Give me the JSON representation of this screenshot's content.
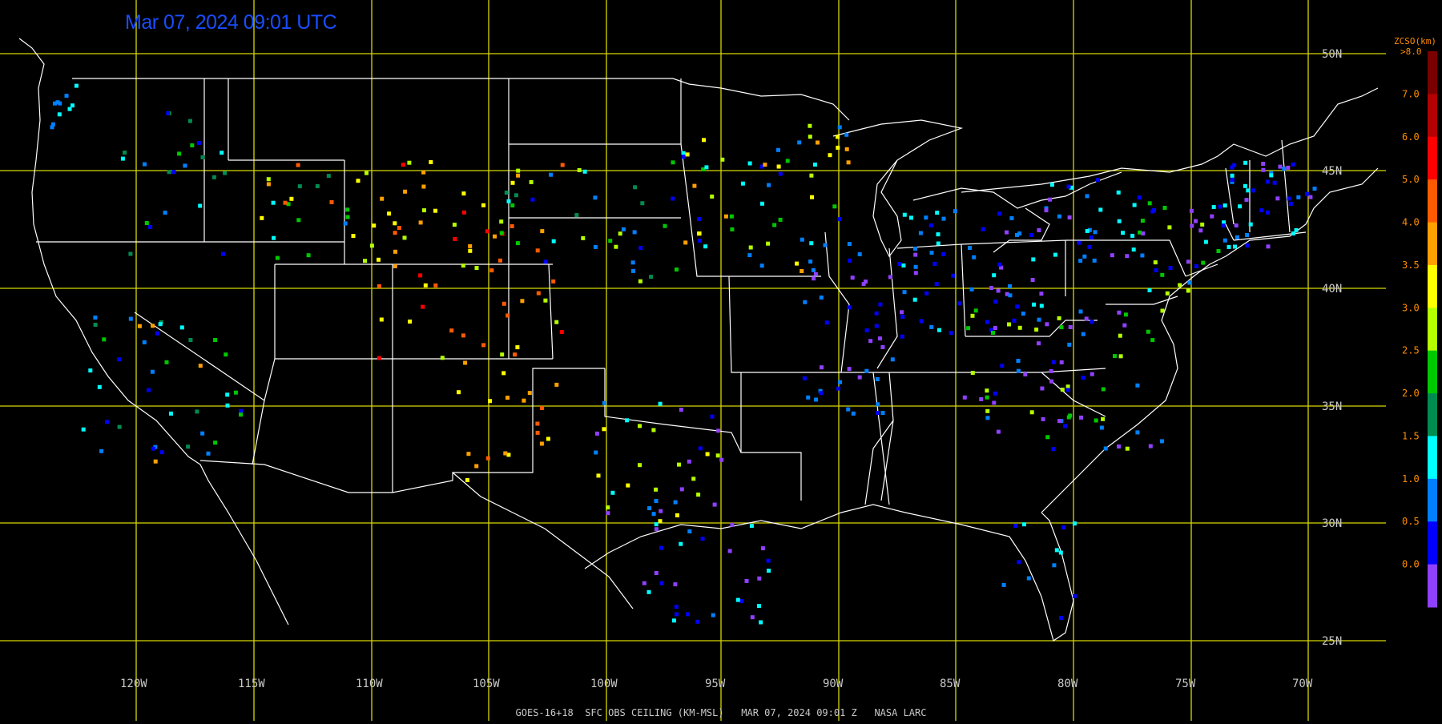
{
  "timestamp": "Mar 07, 2024 09:01 UTC",
  "footer": "GOES-16+18  SFC OBS CEILING (KM-MSL)   MAR 07, 2024 09:01 Z   NASA LARC",
  "colorbar": {
    "unit": "ZCSO(km)",
    "top_label": ">8.0",
    "ticks": [
      "7.0",
      "6.0",
      "5.0",
      "4.0",
      "3.5",
      "3.0",
      "2.5",
      "2.0",
      "1.5",
      "1.0",
      "0.5",
      "0.0"
    ],
    "colors": [
      "#7a0000",
      "#b40000",
      "#ff0000",
      "#ff5a00",
      "#ffa000",
      "#ffff00",
      "#b4ff00",
      "#00c800",
      "#008c50",
      "#00ffff",
      "#0080ff",
      "#0000ff",
      "#9040ff"
    ]
  },
  "grid": {
    "color": "#d8d800",
    "lat_labels": [
      "50N",
      "45N",
      "40N",
      "35N",
      "30N",
      "25N"
    ],
    "lon_labels": [
      "120W",
      "115W",
      "110W",
      "105W",
      "100W",
      "95W",
      "90W",
      "85W",
      "80W",
      "75W",
      "70W"
    ]
  },
  "map_colors": {
    "background": "#000000",
    "borders": "#ffffff",
    "text_gray": "#c8c8c8"
  }
}
